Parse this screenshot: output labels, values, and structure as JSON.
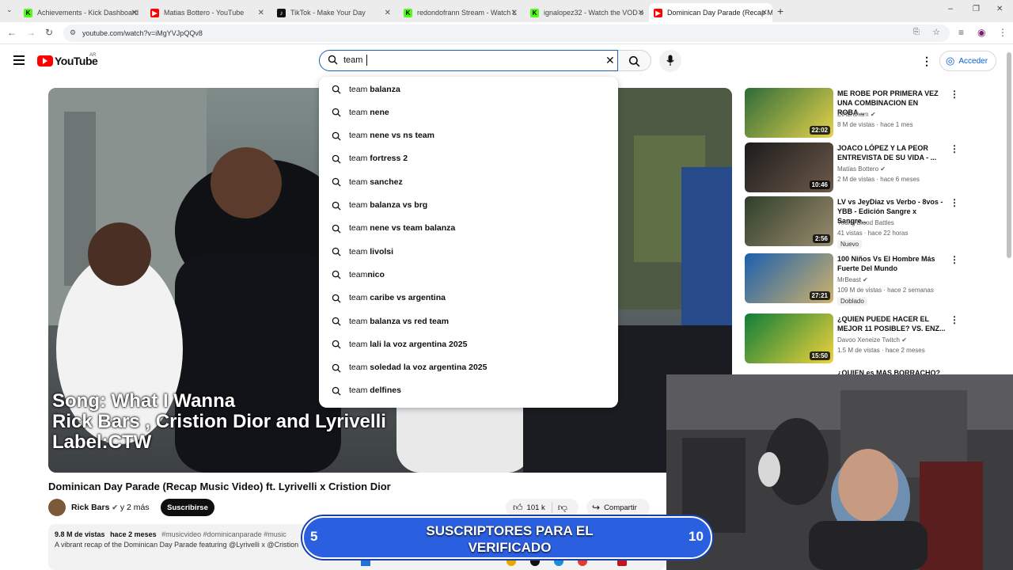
{
  "browser": {
    "tabs": [
      {
        "title": "Achievements - Kick Dashboard",
        "icon": "kick-icon",
        "fav": "K"
      },
      {
        "title": "Matias Bottero - YouTube",
        "icon": "youtube-icon",
        "fav": "▶"
      },
      {
        "title": "TikTok - Make Your Day",
        "icon": "tiktok-icon",
        "fav": "♪"
      },
      {
        "title": "redondofrann Stream - Watch L",
        "icon": "kick-icon",
        "fav": "K"
      },
      {
        "title": "ignalopez32 - Watch the VOD o",
        "icon": "kick-icon",
        "fav": "K"
      },
      {
        "title": "Dominican Day Parade (Recap M",
        "icon": "youtube-icon",
        "fav": "▶"
      }
    ],
    "url": "youtube.com/watch?v=iMgYVJpQQv8"
  },
  "youtube": {
    "logo_text": "YouTube",
    "country": "AR",
    "search_value": "team ",
    "sign_in": "Acceder",
    "suggestions": [
      {
        "pre": "team ",
        "rest": "balanza"
      },
      {
        "pre": "team ",
        "rest": "nene"
      },
      {
        "pre": "team ",
        "rest": "nene vs ns team"
      },
      {
        "pre": "team ",
        "rest": "fortress 2"
      },
      {
        "pre": "team ",
        "rest": "sanchez"
      },
      {
        "pre": "team ",
        "rest": "balanza vs brg"
      },
      {
        "pre": "team ",
        "rest": "nene vs team balanza"
      },
      {
        "pre": "team ",
        "rest": "livolsi"
      },
      {
        "pre": "team",
        "rest": "nico"
      },
      {
        "pre": "team ",
        "rest": "caribe vs argentina"
      },
      {
        "pre": "team ",
        "rest": "balanza vs red team"
      },
      {
        "pre": "team ",
        "rest": "lali la voz argentina 2025"
      },
      {
        "pre": "team ",
        "rest": "soledad la voz argentina 2025"
      },
      {
        "pre": "team ",
        "rest": "delfines"
      }
    ]
  },
  "video": {
    "overlay_lines": [
      "Song: What I Wanna",
      "Rick Bars , Cristion Dior and Lyrivelli",
      "Label:CTW"
    ],
    "title": "Dominican Day Parade (Recap Music Video) ft. Lyrivelli x Cristion Dior",
    "channel": "Rick Bars",
    "more": "y 2 más",
    "subscribe": "Suscribirse",
    "likes": "101 k",
    "share": "Compartir",
    "views": "9.8 M de vistas",
    "date": "hace 2 meses",
    "tags": "#musicvideo #dominicanparade #music",
    "desc": "A vibrant recap of the Dominican Day Parade featuring @Lyrivelli x @Cristion"
  },
  "recommended": [
    {
      "title": "ME ROBE POR PRIMERA VEZ UNA COMBINACION EN ROBA...",
      "channel": "ElAbraham",
      "meta": "8 M de vistas · hace 1 mes",
      "duration": "22:02",
      "badge": ""
    },
    {
      "title": "JOACO LÓPEZ Y LA PEOR ENTREVISTA DE SU VIDA - ...",
      "channel": "Matías Bottero",
      "meta": "2 M de vistas · hace 6 meses",
      "duration": "10:46",
      "badge": ""
    },
    {
      "title": "LV vs JeyDiaz vs Verbo - 8vos - YBB - Edición Sangre x Sangre...",
      "channel": "Young Blood Battles",
      "meta": "41 vistas · hace 22 horas",
      "duration": "2:56",
      "badge": "Nuevo"
    },
    {
      "title": "100 Niños Vs El Hombre Más Fuerte Del Mundo",
      "channel": "MrBeast",
      "meta": "109 M de vistas · hace 2 semanas",
      "duration": "27:21",
      "badge": "Doblado"
    },
    {
      "title": "¿QUIEN PUEDE HACER EL MEJOR 11 POSIBLE? VS. ENZ...",
      "channel": "Davoo Xeneize Twitch",
      "meta": "1.5 M de vistas · hace 2 meses",
      "duration": "15:50",
      "badge": ""
    },
    {
      "title": "¿QUIEN es MAS BORRACHO?",
      "channel": "",
      "meta": "",
      "duration": "",
      "badge": ""
    }
  ],
  "stream_overlay": {
    "left_num": "5",
    "line1": "SUSCRIPTORES PARA EL",
    "line2": "VERIFICADO",
    "right_num": "10",
    "progress": 0.0
  },
  "colors": {
    "accent": "#1c62b9",
    "youtube_red": "#ff0000",
    "kick_green": "#53fc18",
    "overlay_blue": "#2a5fe0"
  }
}
